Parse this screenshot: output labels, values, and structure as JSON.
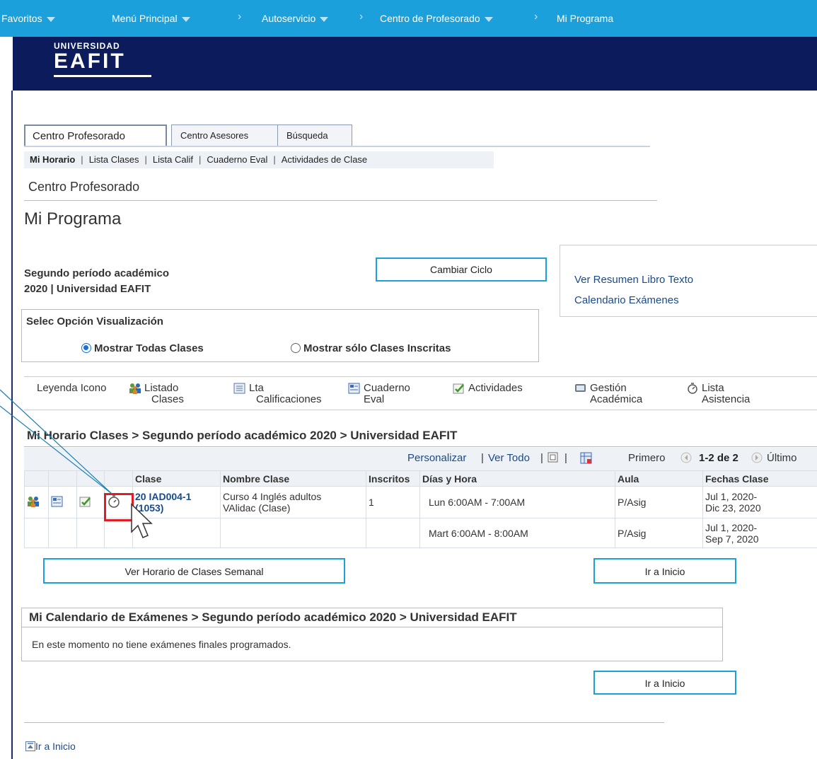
{
  "nav": {
    "favoritos": "Favoritos",
    "menu_principal": "Menú Principal",
    "autoservicio": "Autoservicio",
    "centro_profesorado": "Centro de Profesorado",
    "mi_programa": "Mi Programa",
    "separator": "›"
  },
  "header": {
    "logo_line1": "UNIVERSIDAD",
    "logo_line2": "EAFIT"
  },
  "tabs": [
    {
      "label": "Centro Profesorado",
      "active": true
    },
    {
      "label": "Centro Asesores",
      "active": false
    },
    {
      "label": "Búsqueda",
      "active": false
    }
  ],
  "subnav": {
    "items": [
      "Mi Horario",
      "Lista Clases",
      "Lista Calif",
      "Cuaderno Eval",
      "Actividades de Clase"
    ],
    "separator": "|"
  },
  "breadcrumb": "Centro Profesorado",
  "page_title": "Mi Programa",
  "period": {
    "line1": "Segundo período académico",
    "line2": "2020 | Universidad EAFIT"
  },
  "buttons": {
    "cambiar_ciclo": "Cambiar Ciclo",
    "ver_horario_semanal": "Ver Horario de Clases Semanal",
    "ir_a_inicio": "Ir a Inicio"
  },
  "links": {
    "resumen_libro": "Ver Resumen Libro Texto",
    "calendario_examenes": "Calendario Exámenes",
    "ir_a_inicio_bottom": "Ir a Inicio"
  },
  "visualization": {
    "label": "Selec Opción Visualización",
    "options": [
      {
        "label": "Mostrar Todas Clases",
        "selected": true
      },
      {
        "label": "Mostrar sólo Clases Inscritas",
        "selected": false
      }
    ]
  },
  "legend": {
    "title": "Leyenda Icono",
    "items": [
      {
        "icon": "people-icon",
        "line1": "Listado",
        "line2": "Clases"
      },
      {
        "icon": "grades-list-icon",
        "line1": "Lta",
        "line2": "Calificaciones"
      },
      {
        "icon": "gradebook-icon",
        "line1": "Cuaderno",
        "line2": "Eval"
      },
      {
        "icon": "activities-check-icon",
        "line1": "Actividades",
        "line2": ""
      },
      {
        "icon": "academic-management-icon",
        "line1": "Gestión",
        "line2": "Académica"
      },
      {
        "icon": "stopwatch-icon",
        "line1": "Lista",
        "line2": "Asistencia"
      }
    ]
  },
  "schedule": {
    "title": "Mi Horario Clases > Segundo período académico 2020 > Universidad EAFIT",
    "toolbar": {
      "personalizar": "Personalizar",
      "ver_todo": "Ver Todo",
      "primero": "Primero",
      "range": "1-2 de 2",
      "ultimo": "Último",
      "pipe": "|"
    },
    "columns": [
      "Clase",
      "Nombre Clase",
      "Inscritos",
      "Días y Hora",
      "Aula",
      "Fechas Clase"
    ],
    "rows": [
      {
        "clase_line1": "20 IAD004-1",
        "clase_line2": "(1053)",
        "nombre_line1": "Curso 4 Inglés adultos",
        "nombre_line2": "VAlidac (Clase)",
        "inscritos": "1",
        "dias_hora": "Lun 6:00AM - 7:00AM",
        "aula": "P/Asig",
        "fechas_line1": "Jul 1, 2020-",
        "fechas_line2": "Dic 23, 2020"
      },
      {
        "dias_hora": "Mart 6:00AM - 8:00AM",
        "aula": "P/Asig",
        "fechas_line1": "Jul 1, 2020-",
        "fechas_line2": "Sep 7, 2020"
      }
    ]
  },
  "exams": {
    "title": "Mi Calendario de Exámenes > Segundo período académico 2020 > Universidad EAFIT",
    "message": "En este momento no tiene exámenes finales programados."
  },
  "colors": {
    "nav_bg": "#1ba0db",
    "header_bg": "#0b1b5b",
    "link": "#1a4a8a",
    "highlight": "#e31b23"
  }
}
